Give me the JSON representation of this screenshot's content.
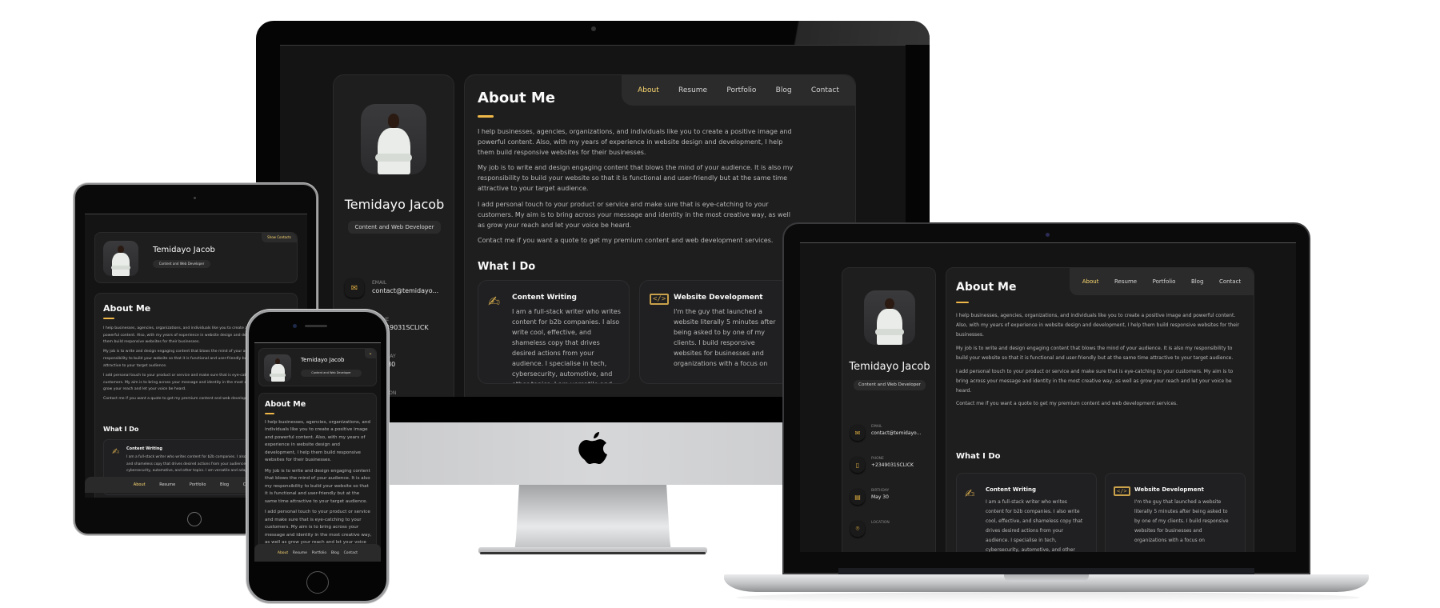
{
  "profile": {
    "name": "Temidayo Jacob",
    "role": "Content and Web Developer",
    "show_contacts": "Show Contacts"
  },
  "contacts": [
    {
      "icon": "mail-icon",
      "label": "Email",
      "value": "contact@temidayo..."
    },
    {
      "icon": "phone-icon",
      "label": "Phone",
      "value": "+2349031SCLICK"
    },
    {
      "icon": "calendar-icon",
      "label": "Birthday",
      "value": "May 30"
    },
    {
      "icon": "location-icon",
      "label": "Location",
      "value": ""
    }
  ],
  "nav": {
    "items": [
      "About",
      "Resume",
      "Portfolio",
      "Blog",
      "Contact"
    ],
    "active": "About"
  },
  "about": {
    "title": "About Me",
    "paragraphs": [
      "I help businesses, agencies, organizations, and individuals like you to create a positive image and powerful content. Also, with my years of experience in website design and development, I help them build responsive websites for their businesses.",
      "My job is to write and design engaging content that blows the mind of your audience. It is also my responsibility to build your website so that it is functional and user-friendly but at the same time attractive to your target audience.",
      "I add personal touch to your product or service and make sure that is eye-catching to your customers. My aim is to bring across your message and identity in the most creative way, as well as grow your reach and let your voice be heard.",
      "Contact me if you want a quote to get my premium content and web development services."
    ]
  },
  "what_i_do": {
    "title": "What I Do",
    "services": [
      {
        "icon": "pen-writing-icon",
        "title": "Content Writing",
        "desc": "I am a full-stack writer who writes content for b2b companies. I also write cool, effective, and shameless copy that drives desired actions from your audience. I specialise in tech, cybersecurity, automotive, and other topics. I am versatile and adaptable."
      },
      {
        "icon": "code-window-icon",
        "title": "Website Development",
        "desc": "I'm the guy that launched a website literally 5 minutes after being asked to by one of my clients. I build responsive websites for businesses and organizations with a focus on"
      }
    ]
  },
  "colors": {
    "accent": "#ffdb70",
    "accent_bar": "#f0b848",
    "background": "#121212",
    "card": "#1e1e1f"
  }
}
